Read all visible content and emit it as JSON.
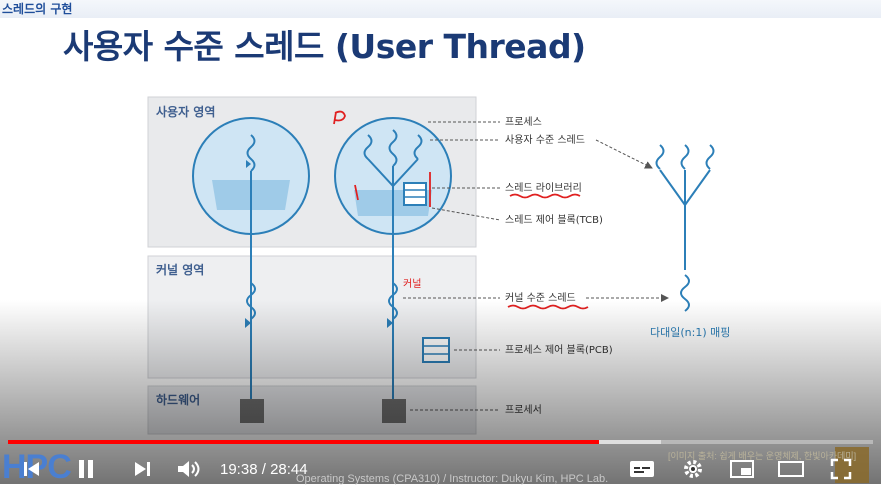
{
  "breadcrumb": "스레드의 구현",
  "slide_title": "사용자 수준 스레드 (User Thread)",
  "regions": {
    "user": "사용자 영역",
    "kernel": "커널 영역",
    "hardware": "하드웨어"
  },
  "labels": {
    "process": "프로세스",
    "user_thread": "사용자 수준 스레드",
    "thread_library": "스레드 라이브러리",
    "tcb": "스레드 제어 블록(TCB)",
    "kernel_thread": "커널 수준 스레드",
    "pcb": "프로세스 제어 블록(PCB)",
    "processor": "프로세서",
    "mapping": "다대일(n:1) 매핑"
  },
  "annotations": {
    "p1": "P1",
    "kernel_note": "커널"
  },
  "player": {
    "time_current": "19:38",
    "time_total": "28:44",
    "time_separator": "/",
    "progress": 0.683,
    "buffered": 0.755,
    "logo": "HPC",
    "footer": "Operating Systems (CPA310) / Instructor: Dukyu Kim, HPC Lab.",
    "watermark": "[이미지 출처: 쉽게 배우는 운영체제, 한빛아카데미]"
  },
  "colors": {
    "title": "#1b3a75",
    "diagram_line": "#2c7fb8",
    "annotation_red": "#e02020",
    "progress": "#ff0000"
  }
}
